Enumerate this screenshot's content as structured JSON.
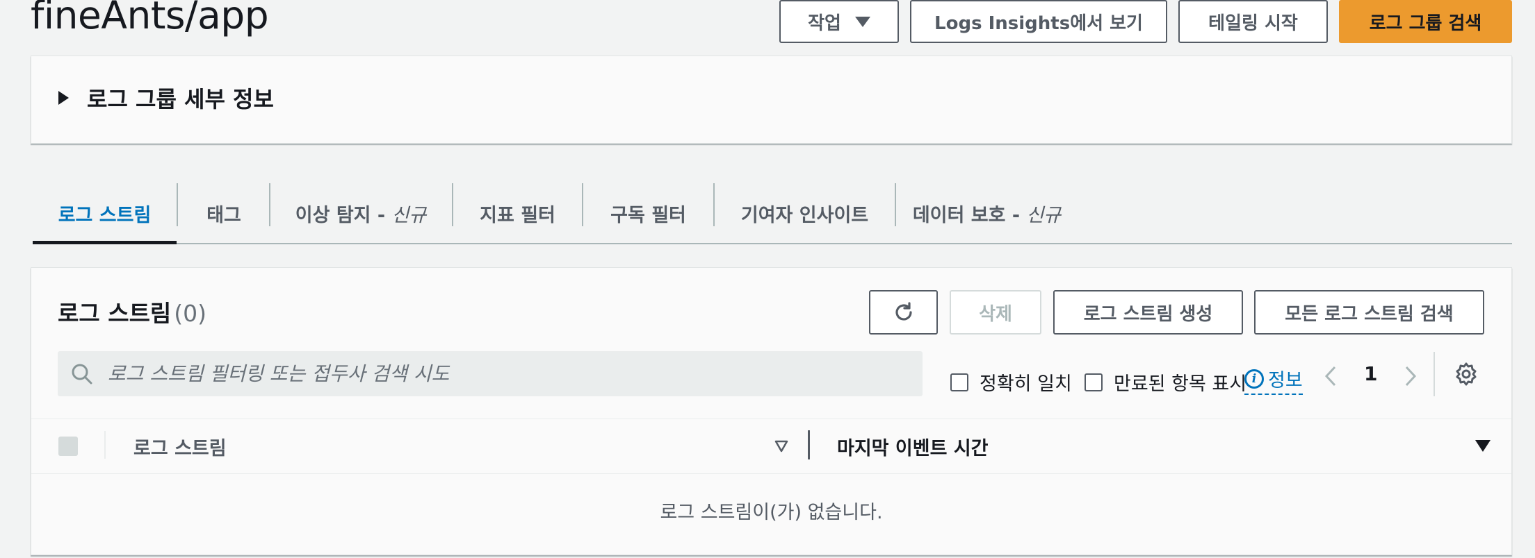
{
  "header": {
    "title": "fineAnts/app",
    "actions_label": "작업",
    "logs_insights_label": "Logs Insights에서 보기",
    "tail_label": "테일링 시작",
    "search_group_label": "로그 그룹 검색"
  },
  "details": {
    "label": "로그 그룹 세부 정보"
  },
  "tabs": [
    {
      "label": "로그 스트림",
      "suffix": ""
    },
    {
      "label": "태그",
      "suffix": ""
    },
    {
      "label": "이상 탐지 - ",
      "suffix": "신규"
    },
    {
      "label": "지표 필터",
      "suffix": ""
    },
    {
      "label": "구독 필터",
      "suffix": ""
    },
    {
      "label": "기여자 인사이트",
      "suffix": ""
    },
    {
      "label": "데이터 보호 - ",
      "suffix": "신규"
    }
  ],
  "streams": {
    "title": "로그 스트림",
    "count": "(0)",
    "delete_label": "삭제",
    "create_label": "로그 스트림 생성",
    "search_all_label": "모든 로그 스트림 검색",
    "search_placeholder": "로그 스트림 필터링 또는 접두사 검색 시도",
    "exact_match_label": "정확히 일치",
    "show_expired_label": "만료된 항목 표시",
    "info_label": "정보",
    "page": "1",
    "columns": [
      "로그 스트림",
      "마지막 이벤트 시간"
    ],
    "empty_text": "로그 스트림이(가) 없습니다."
  },
  "colors": {
    "primary": "#ec9a2e",
    "link": "#0073bb",
    "background": "#f2f3f3"
  },
  "icons": [
    "caret-down-icon",
    "expand-triangle-icon",
    "refresh-icon",
    "search-icon",
    "info-icon",
    "chevron-left-icon",
    "chevron-right-icon",
    "settings-gear-icon",
    "sort-icon"
  ]
}
